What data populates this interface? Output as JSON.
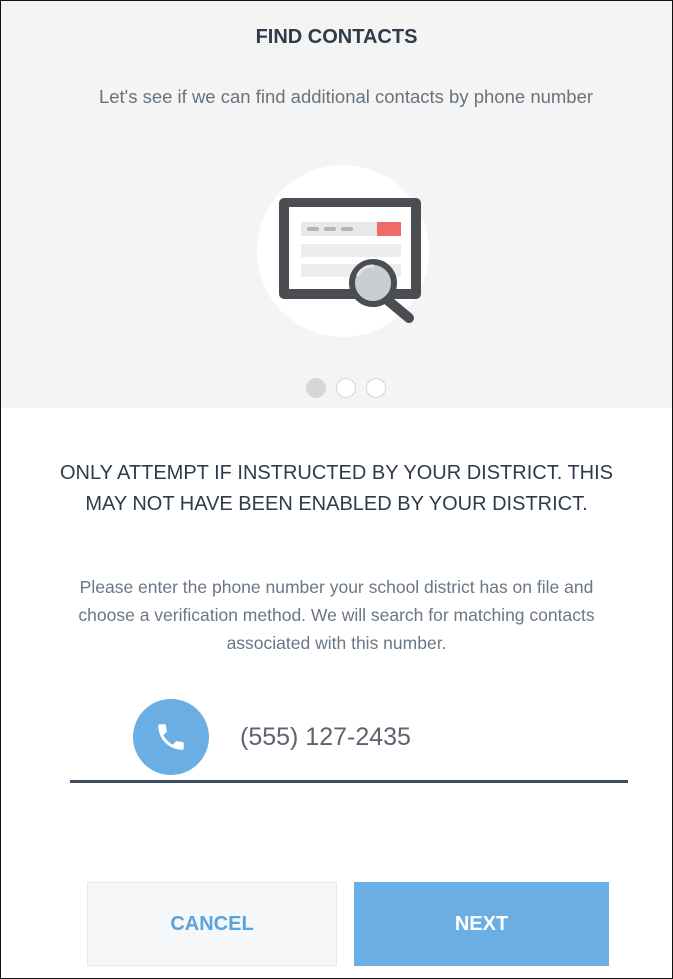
{
  "header": {
    "title": "FIND CONTACTS",
    "subtitle": "Let's see if we can find additional contacts by phone number"
  },
  "carousel": {
    "total_steps": 3,
    "current_step": 1
  },
  "notice": {
    "warning": "ONLY ATTEMPT IF INSTRUCTED BY YOUR DISTRICT. THIS MAY NOT HAVE BEEN ENABLED BY YOUR DISTRICT.",
    "instructions": "Please enter the phone number your school district has on file and choose a verification method. We will search for matching contacts associated with this number."
  },
  "phone": {
    "value": "(555) 127-2435",
    "icon": "phone-icon"
  },
  "actions": {
    "cancel_label": "CANCEL",
    "next_label": "NEXT"
  },
  "colors": {
    "accent": "#6aaee3",
    "title_text": "#2f3b48",
    "panel_bg": "#f4f4f4",
    "highlight_red": "#f06a6a"
  }
}
